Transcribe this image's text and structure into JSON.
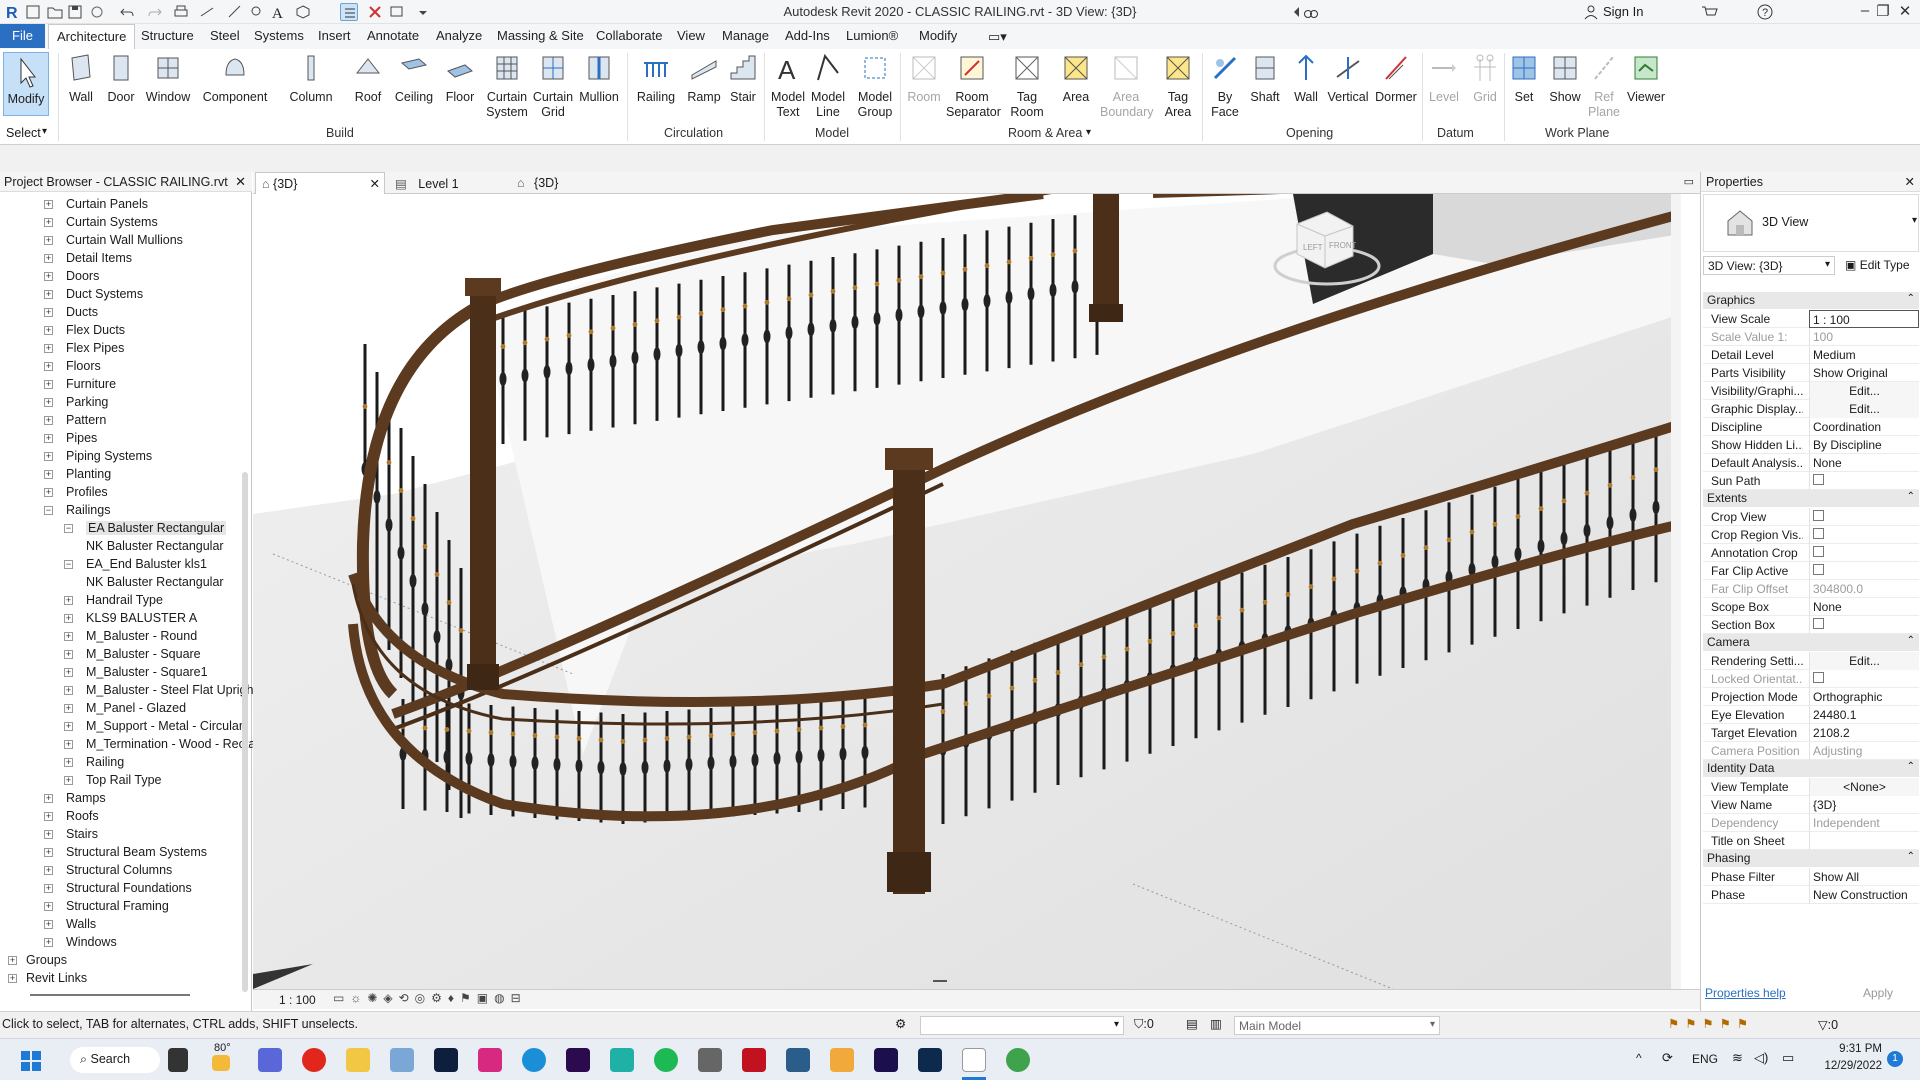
{
  "window": {
    "title": "Autodesk Revit 2020 - CLASSIC RAILING.rvt - 3D View: {3D}",
    "sign_in": "Sign In"
  },
  "menu": {
    "tabs": [
      "File",
      "Architecture",
      "Structure",
      "Steel",
      "Systems",
      "Insert",
      "Annotate",
      "Analyze",
      "Massing & Site",
      "Collaborate",
      "View",
      "Manage",
      "Add-Ins",
      "Lumion®",
      "Modify"
    ],
    "active": "Architecture"
  },
  "ribbon": {
    "select": {
      "modify": "Modify",
      "label": "Select"
    },
    "build": {
      "label": "Build",
      "buttons": [
        "Wall",
        "Door",
        "Window",
        "Component",
        "Column",
        "Roof",
        "Ceiling",
        "Floor",
        "Curtain\nSystem",
        "Curtain\nGrid",
        "Mullion"
      ]
    },
    "circulation": {
      "label": "Circulation",
      "buttons": [
        "Railing",
        "Ramp",
        "Stair"
      ]
    },
    "model": {
      "label": "Model",
      "buttons": [
        "Model\nText",
        "Model\nLine",
        "Model\nGroup"
      ]
    },
    "room_area": {
      "label": "Room & Area",
      "buttons": [
        "Room",
        "Room\nSeparator",
        "Tag\nRoom",
        "Area",
        "Area\nBoundary",
        "Tag\nArea"
      ]
    },
    "opening": {
      "label": "Opening",
      "buttons": [
        "By\nFace",
        "Shaft",
        "Wall",
        "Vertical",
        "Dormer"
      ]
    },
    "datum": {
      "label": "Datum",
      "buttons": [
        "Level",
        "Grid"
      ]
    },
    "work_plane": {
      "label": "Work Plane",
      "buttons": [
        "Set",
        "Show",
        "Ref\nPlane",
        "Viewer"
      ]
    }
  },
  "project_browser": {
    "title": "Project Browser - CLASSIC RAILING.rvt",
    "items": [
      {
        "label": "Curtain Panels",
        "level": 1
      },
      {
        "label": "Curtain Systems",
        "level": 1
      },
      {
        "label": "Curtain Wall Mullions",
        "level": 1
      },
      {
        "label": "Detail Items",
        "level": 1
      },
      {
        "label": "Doors",
        "level": 1
      },
      {
        "label": "Duct Systems",
        "level": 1
      },
      {
        "label": "Ducts",
        "level": 1
      },
      {
        "label": "Flex Ducts",
        "level": 1
      },
      {
        "label": "Flex Pipes",
        "level": 1
      },
      {
        "label": "Floors",
        "level": 1
      },
      {
        "label": "Furniture",
        "level": 1
      },
      {
        "label": "Parking",
        "level": 1
      },
      {
        "label": "Pattern",
        "level": 1
      },
      {
        "label": "Pipes",
        "level": 1
      },
      {
        "label": "Piping Systems",
        "level": 1
      },
      {
        "label": "Planting",
        "level": 1
      },
      {
        "label": "Profiles",
        "level": 1
      },
      {
        "label": "Railings",
        "level": 1,
        "expanded": true
      },
      {
        "label": "EA Baluster Rectangular",
        "level": 2,
        "expanded": true,
        "selected": true
      },
      {
        "label": "NK Baluster Rectangular",
        "level": 3
      },
      {
        "label": "EA_End Baluster kls1",
        "level": 2,
        "expanded": true
      },
      {
        "label": "NK Baluster Rectangular",
        "level": 3
      },
      {
        "label": "Handrail Type",
        "level": 2
      },
      {
        "label": "KLS9 BALUSTER A",
        "level": 2
      },
      {
        "label": "M_Baluster - Round",
        "level": 2
      },
      {
        "label": "M_Baluster - Square",
        "level": 2
      },
      {
        "label": "M_Baluster - Square1",
        "level": 2
      },
      {
        "label": "M_Baluster - Steel Flat Upright",
        "level": 2
      },
      {
        "label": "M_Panel - Glazed",
        "level": 2
      },
      {
        "label": "M_Support - Metal - Circular",
        "level": 2
      },
      {
        "label": "M_Termination - Wood - Rectan",
        "level": 2
      },
      {
        "label": "Railing",
        "level": 2
      },
      {
        "label": "Top Rail Type",
        "level": 2
      },
      {
        "label": "Ramps",
        "level": 1
      },
      {
        "label": "Roofs",
        "level": 1
      },
      {
        "label": "Stairs",
        "level": 1
      },
      {
        "label": "Structural Beam Systems",
        "level": 1
      },
      {
        "label": "Structural Columns",
        "level": 1
      },
      {
        "label": "Structural Foundations",
        "level": 1
      },
      {
        "label": "Structural Framing",
        "level": 1
      },
      {
        "label": "Walls",
        "level": 1
      },
      {
        "label": "Windows",
        "level": 1
      },
      {
        "label": "Groups",
        "level": 0
      },
      {
        "label": "Revit Links",
        "level": 0
      }
    ]
  },
  "view_tabs": [
    {
      "label": "{3D}",
      "active": true
    },
    {
      "label": "Level 1",
      "active": false
    },
    {
      "label": "{3D}",
      "active": false
    }
  ],
  "viewcube": {
    "left": "LEFT",
    "front": "FRONT"
  },
  "view_status": {
    "scale": "1 : 100"
  },
  "properties": {
    "title": "Properties",
    "type_name": "3D View",
    "selector": "3D View: {3D}",
    "edit_type": "Edit Type",
    "groups": [
      {
        "name": "Graphics",
        "rows": [
          {
            "k": "View Scale",
            "v": "1 : 100"
          },
          {
            "k": "Scale Value    1:",
            "v": "100",
            "disabled": true
          },
          {
            "k": "Detail Level",
            "v": "Medium"
          },
          {
            "k": "Parts Visibility",
            "v": "Show Original"
          },
          {
            "k": "Visibility/Graphi...",
            "v": "Edit...",
            "btn": true
          },
          {
            "k": "Graphic Display...",
            "v": "Edit...",
            "btn": true
          },
          {
            "k": "Discipline",
            "v": "Coordination"
          },
          {
            "k": "Show Hidden Li...",
            "v": "By Discipline"
          },
          {
            "k": "Default Analysis...",
            "v": "None"
          },
          {
            "k": "Sun Path",
            "v": "",
            "check": true
          }
        ]
      },
      {
        "name": "Extents",
        "rows": [
          {
            "k": "Crop View",
            "v": "",
            "check": true
          },
          {
            "k": "Crop Region Vis...",
            "v": "",
            "check": true
          },
          {
            "k": "Annotation Crop",
            "v": "",
            "check": true
          },
          {
            "k": "Far Clip Active",
            "v": "",
            "check": true
          },
          {
            "k": "Far Clip Offset",
            "v": "304800.0",
            "disabled": true
          },
          {
            "k": "Scope Box",
            "v": "None"
          },
          {
            "k": "Section Box",
            "v": "",
            "check": true
          }
        ]
      },
      {
        "name": "Camera",
        "rows": [
          {
            "k": "Rendering Setti...",
            "v": "Edit...",
            "btn": true
          },
          {
            "k": "Locked Orientat...",
            "v": "",
            "check": true,
            "disabled": true
          },
          {
            "k": "Projection Mode",
            "v": "Orthographic"
          },
          {
            "k": "Eye Elevation",
            "v": "24480.1"
          },
          {
            "k": "Target Elevation",
            "v": "2108.2"
          },
          {
            "k": "Camera Position",
            "v": "Adjusting",
            "disabled": true
          }
        ]
      },
      {
        "name": "Identity Data",
        "rows": [
          {
            "k": "View Template",
            "v": "<None>",
            "btn": true
          },
          {
            "k": "View Name",
            "v": "{3D}"
          },
          {
            "k": "Dependency",
            "v": "Independent",
            "disabled": true
          },
          {
            "k": "Title on Sheet",
            "v": ""
          }
        ]
      },
      {
        "name": "Phasing",
        "rows": [
          {
            "k": "Phase Filter",
            "v": "Show All"
          },
          {
            "k": "Phase",
            "v": "New Construction"
          }
        ]
      }
    ],
    "help": "Properties help",
    "apply": "Apply"
  },
  "statusbar": {
    "hint": "Click to select, TAB for alternates, CTRL adds, SHIFT unselects.",
    "filter_count": ":0",
    "model": "Main Model",
    "select_count": ":0"
  },
  "taskbar": {
    "search": "Search",
    "weather": "80°",
    "lang": "ENG",
    "time": "9:31 PM",
    "date": "12/29/2022",
    "notifications": "1"
  },
  "colors": {
    "accent": "#2a6fc1",
    "wood": "#5b3a20",
    "iron": "#1a1a1a"
  }
}
